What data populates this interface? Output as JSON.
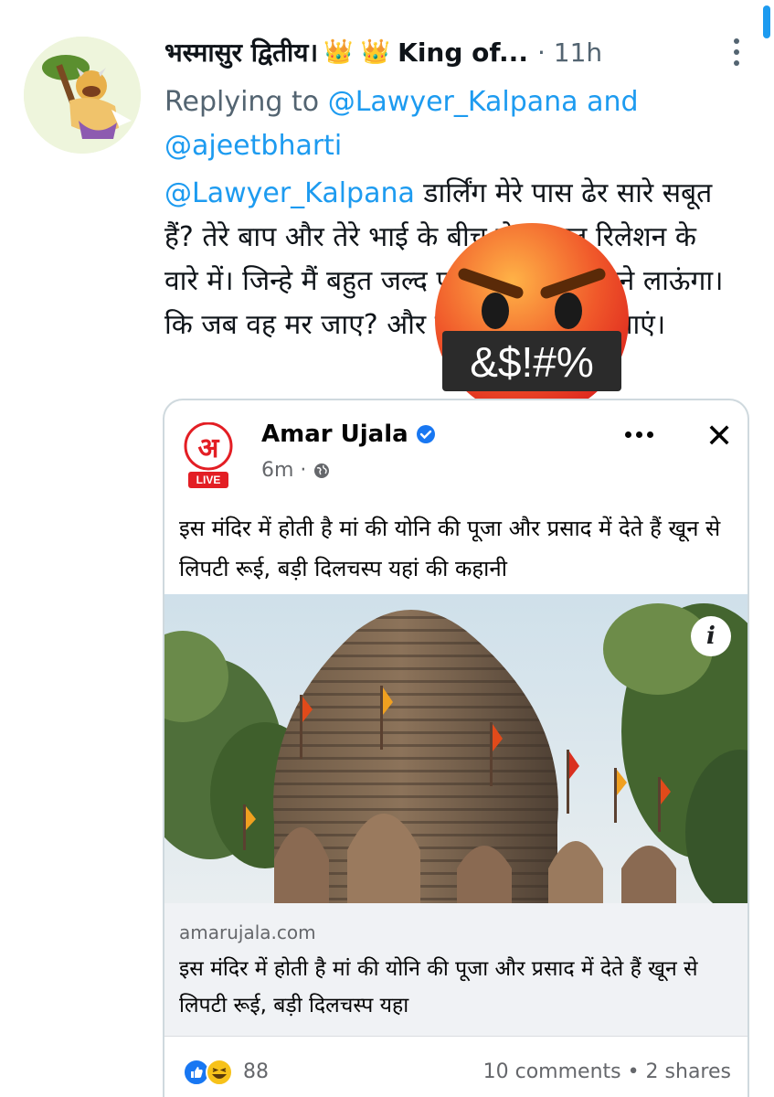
{
  "tweet": {
    "display_name": "भस्मासुर द्वितीय।",
    "crowns": "👑 👑",
    "name_suffix": "King of...",
    "time": "· 11h",
    "replying_prefix": "Replying to",
    "replying_to_1": "@Lawyer_Kalpana",
    "replying_and": "and",
    "replying_to_2": "@ajeetbharti",
    "text_mention": "@Lawyer_Kalpana",
    "text_body": "  डार्लिंग मेरे पास ढेर सारे सबूत हैं? तेरे बाप और तेरे भाई के बीच सेक्सुअल रिलेशन के वारे में। जिन्हे मैं बहुत जल्द पूरी दुनिया के सामने लाऊंगा।  कि जब वह मर जाए? और उसके कीड़े न पड़ जाएं।",
    "sticker_text": "&$!#%"
  },
  "embed": {
    "logo_letter": "अ",
    "logo_badge": "LIVE",
    "page_name": "Amar Ujala",
    "meta_time": "6m ·",
    "caption": "इस मंदिर में होती है मां की योनि की पूजा और प्रसाद में देते हैं खून से लिपटी रूई, बड़ी दिलचस्प यहां की कहानी",
    "info_icon": "i",
    "link_domain": "amarujala.com",
    "link_title": "इस मंदिर में होती है मां की योनि की पूजा और प्रसाद में देते हैं खून से लिपटी रूई, बड़ी दिलचस्प यहा",
    "reaction_count": "88",
    "engagement": "10 comments • 2 shares",
    "close_icon": "✕"
  },
  "colors": {
    "accent": "#1d9bf0",
    "muted": "#536471",
    "fb_blue": "#1877f2",
    "amar_red": "#e31e24"
  },
  "icons": [
    "more-icon",
    "verified-icon",
    "globe-icon",
    "close-icon",
    "info-icon",
    "like-reaction-icon",
    "haha-reaction-icon",
    "angry-emoji-icon"
  ]
}
